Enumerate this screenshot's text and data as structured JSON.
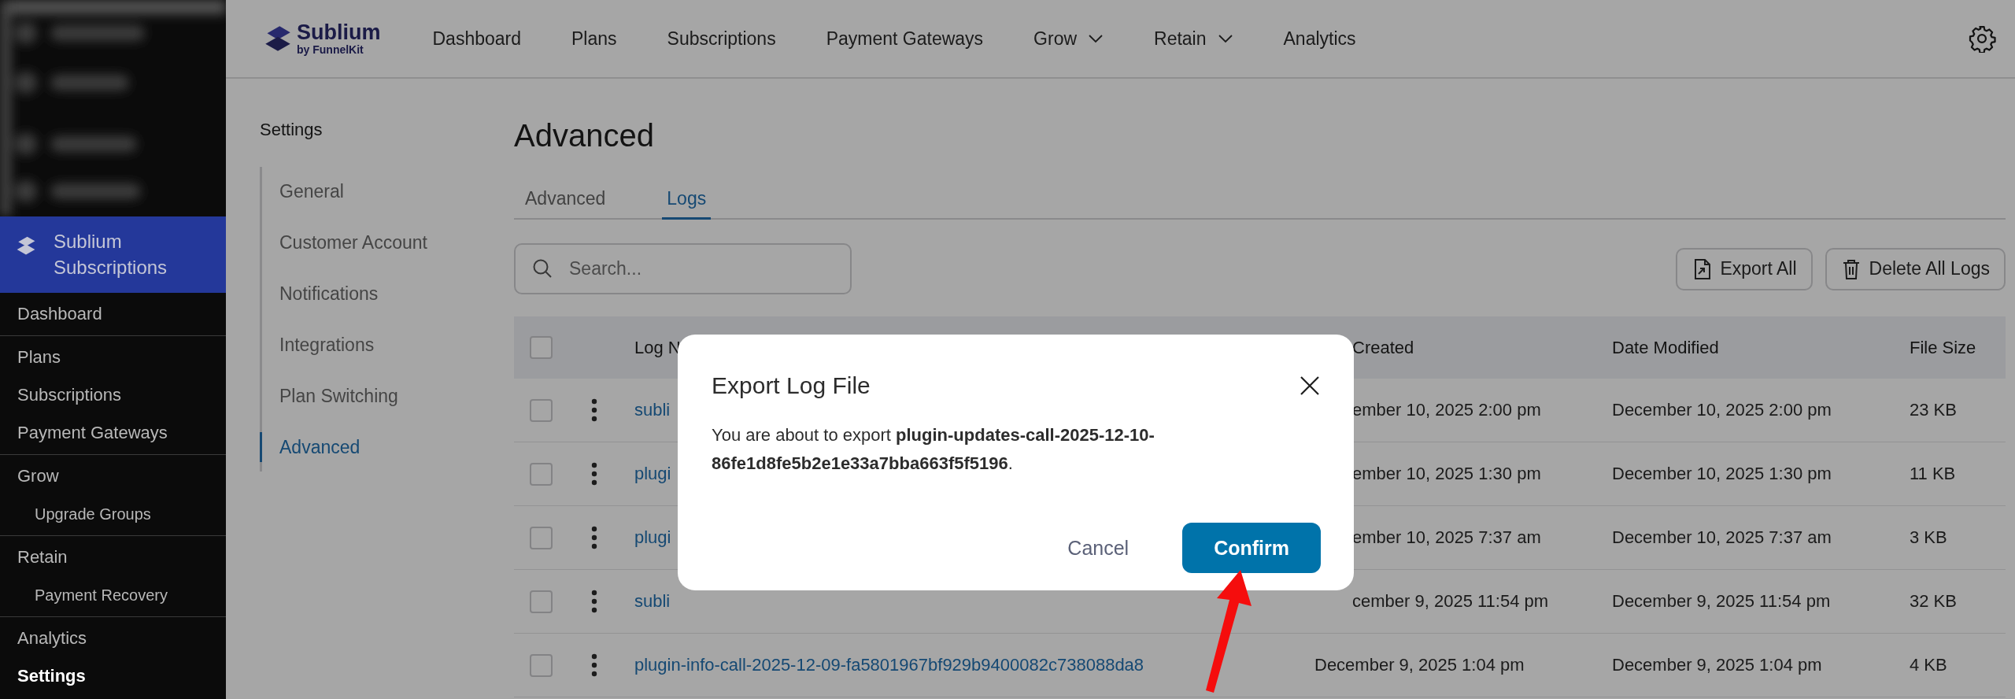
{
  "admin_sidebar": {
    "plugin_title": "Sublium Subscriptions",
    "groups": [
      {
        "items": [
          {
            "label": "Dashboard",
            "selected": false
          }
        ]
      },
      {
        "items": [
          {
            "label": "Plans",
            "selected": false
          },
          {
            "label": "Subscriptions",
            "selected": false
          },
          {
            "label": "Payment Gateways",
            "selected": false
          }
        ]
      },
      {
        "items": [
          {
            "label": "Grow",
            "selected": false,
            "children": [
              {
                "label": "Upgrade Groups",
                "selected": false
              }
            ]
          }
        ]
      },
      {
        "items": [
          {
            "label": "Retain",
            "selected": false,
            "children": [
              {
                "label": "Payment Recovery",
                "selected": false
              }
            ]
          }
        ]
      },
      {
        "items": [
          {
            "label": "Analytics",
            "selected": false
          },
          {
            "label": "Settings",
            "selected": true
          }
        ]
      }
    ]
  },
  "header": {
    "brand": {
      "name": "Sublium",
      "byline": "by FunnelKit"
    },
    "nav": [
      {
        "label": "Dashboard",
        "dropdown": false
      },
      {
        "label": "Plans",
        "dropdown": false
      },
      {
        "label": "Subscriptions",
        "dropdown": false
      },
      {
        "label": "Payment Gateways",
        "dropdown": false
      },
      {
        "label": "Grow",
        "dropdown": true
      },
      {
        "label": "Retain",
        "dropdown": true
      },
      {
        "label": "Analytics",
        "dropdown": false
      }
    ]
  },
  "settings_nav": {
    "title": "Settings",
    "items": [
      {
        "label": "General",
        "selected": false
      },
      {
        "label": "Customer Account",
        "selected": false
      },
      {
        "label": "Notifications",
        "selected": false
      },
      {
        "label": "Integrations",
        "selected": false
      },
      {
        "label": "Plan Switching",
        "selected": false
      },
      {
        "label": "Advanced",
        "selected": true
      }
    ]
  },
  "page": {
    "title": "Advanced",
    "tabs": [
      {
        "label": "Advanced",
        "selected": false
      },
      {
        "label": "Logs",
        "selected": true
      }
    ],
    "search": {
      "placeholder": "Search..."
    },
    "actions": [
      {
        "kind": "export",
        "label": "Export All"
      },
      {
        "kind": "delete",
        "label": "Delete All Logs"
      }
    ],
    "table": {
      "all_checked": false,
      "columns": [
        "Log N",
        "Created",
        "Date Modified",
        "File Size"
      ],
      "rows": [
        {
          "checked": false,
          "name": "subli",
          "created": "ember 10, 2025 2:00 pm",
          "modified": "December 10, 2025 2:00 pm",
          "size": "23 KB"
        },
        {
          "checked": false,
          "name": "plugi",
          "created": "ember 10, 2025 1:30 pm",
          "modified": "December 10, 2025 1:30 pm",
          "size": "11 KB"
        },
        {
          "checked": false,
          "name": "plugi",
          "created": "ember 10, 2025 7:37 am",
          "modified": "December 10, 2025 7:37 am",
          "size": "3 KB"
        },
        {
          "checked": false,
          "name": "subli",
          "created": "cember 9, 2025 11:54 pm",
          "modified": "December 9, 2025 11:54 pm",
          "size": "32 KB"
        },
        {
          "checked": false,
          "name": "plugin-info-call-2025-12-09-fa5801967bf929b9400082c738088da8",
          "created": "December 9, 2025 1:04 pm",
          "modified": "December 9, 2025 1:04 pm",
          "size": "4 KB"
        }
      ]
    }
  },
  "modal": {
    "title": "Export Log File",
    "message": "You are about to export **plugin-updates-call-2025-12-10-86fe1d8fe5b2e1e33a7bba663f5f5196**.",
    "buttons": [
      {
        "kind": "cancel",
        "label": "Cancel"
      },
      {
        "kind": "confirm",
        "label": "Confirm"
      }
    ]
  }
}
